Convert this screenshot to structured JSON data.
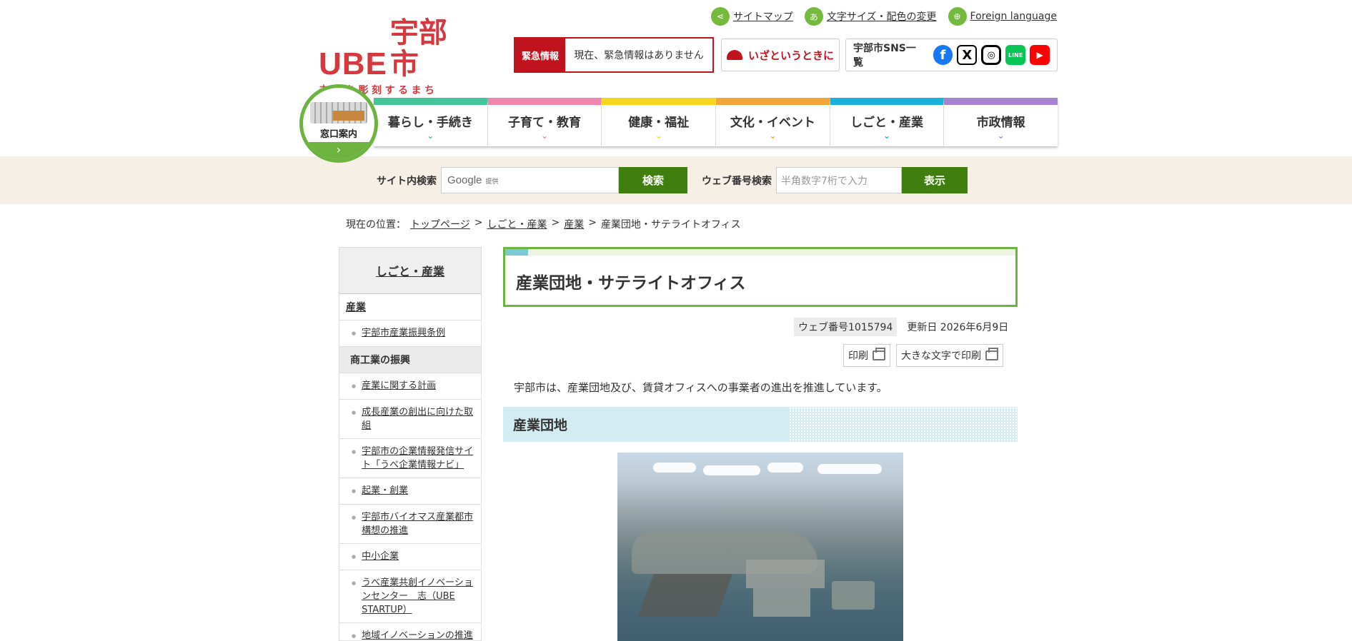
{
  "header": {
    "logo_ube": "UBE",
    "logo_city": "宇部市",
    "logo_sub": "未来を彫刻するまち",
    "util": [
      {
        "label": "サイトマップ",
        "icon": "share-icon"
      },
      {
        "label": "文字サイズ・配色の変更",
        "icon": "font-size-icon"
      },
      {
        "label": "Foreign language",
        "icon": "globe-icon"
      }
    ],
    "emergency_label": "緊急情報",
    "emergency_text": "現在、緊急情報はありません",
    "iza_label": "いざというときに",
    "sns_label": "宇部市SNS一覧",
    "sns_icons": {
      "facebook": "f",
      "x": "X",
      "instagram": "◎",
      "line": "LINE",
      "youtube": "▶"
    }
  },
  "nav": {
    "madoguchi": "窓口案内",
    "madoguchi_arrow": "›",
    "items": [
      {
        "label": "暮らし・手続き",
        "color": "#45c39b"
      },
      {
        "label": "子育て・教育",
        "color": "#ee86ae"
      },
      {
        "label": "健康・福祉",
        "color": "#f5d520"
      },
      {
        "label": "文化・イベント",
        "color": "#f4a63a"
      },
      {
        "label": "しごと・産業",
        "color": "#1bb0de"
      },
      {
        "label": "市政情報",
        "color": "#a784d2"
      }
    ],
    "chevron": "⌄"
  },
  "search": {
    "site_label": "サイト内検索",
    "google": "Google",
    "google_sub": "提供",
    "search_button": "検索",
    "web_label": "ウェブ番号検索",
    "web_placeholder": "半角数字7桁で入力",
    "show_button": "表示"
  },
  "breadcrumb": {
    "prefix": "現在の位置：",
    "links": [
      "トップページ",
      "しごと・産業",
      "産業"
    ],
    "sep": ">",
    "current": "産業団地・サテライトオフィス"
  },
  "sidebar": {
    "head": "しごと・産業",
    "cat1": "産業",
    "cat1_items": [
      "宇部市産業振興条例"
    ],
    "cat2": "商工業の振興",
    "cat2_items": [
      "産業に関する計画",
      "成長産業の創出に向けた取組",
      "宇部市の企業情報発信サイト「うべ企業情報ナビ」",
      "起業・創業",
      "宇部市バイオマス産業都市構想の推進",
      "中小企業",
      "うべ産業共創イノベーションセンター　志（UBE STARTUP）",
      "地域イノベーションの推進"
    ]
  },
  "main": {
    "title": "産業団地・サテライトオフィス",
    "web_no": "ウェブ番号1015794",
    "updated": "更新日 2026年6月9日",
    "print": "印刷",
    "print_large": "大きな文字で印刷",
    "intro": "宇部市は、産業団地及び、賃貸オフィスへの事業者の進出を推進しています。",
    "h2": "産業団地"
  }
}
